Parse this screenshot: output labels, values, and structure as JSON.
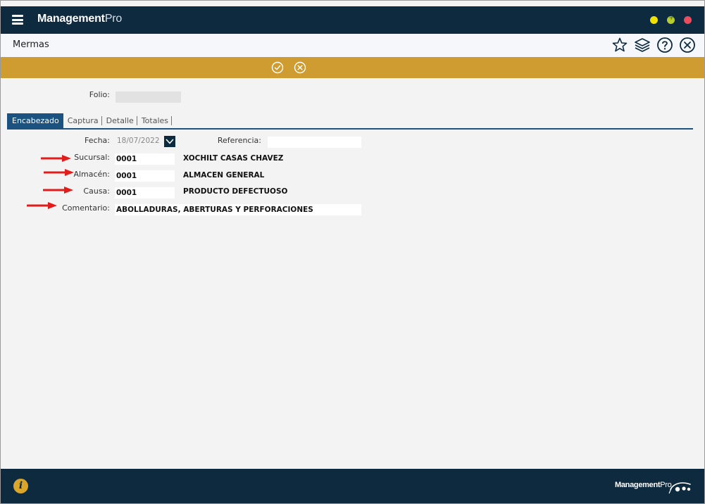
{
  "app": {
    "name_bold": "Management",
    "name_light": "Pro"
  },
  "page": {
    "title": "Mermas"
  },
  "title_icons": [
    "star-icon",
    "layers-icon",
    "help-icon",
    "close-icon"
  ],
  "action_bar": {
    "accept_icon": "check-circle-icon",
    "cancel_icon": "x-circle-icon"
  },
  "form": {
    "folio": {
      "label": "Folio:",
      "value": ""
    },
    "tabs": [
      "Encabezado",
      "Captura",
      "Detalle",
      "Totales"
    ],
    "active_tab": "Encabezado",
    "fecha": {
      "label": "Fecha:",
      "value": "18/07/2022"
    },
    "referencia": {
      "label": "Referencia:",
      "value": ""
    },
    "sucursal": {
      "label": "Sucursal:",
      "code": "0001",
      "description": "XOCHILT CASAS CHAVEZ"
    },
    "almacen": {
      "label": "Almacén:",
      "code": "0001",
      "description": "ALMACEN GENERAL"
    },
    "causa": {
      "label": "Causa:",
      "code": "0001",
      "description": "PRODUCTO DEFECTUOSO"
    },
    "comentario": {
      "label": "Comentario:",
      "value": "ABOLLADURAS, ABERTURAS Y PERFORACIONES"
    }
  },
  "footer": {
    "brand_bold": "Management",
    "brand_light": "Pro"
  },
  "colors": {
    "navy": "#0e2a3f",
    "gold": "#cf9c31",
    "tab_blue": "#1b527f",
    "arrow_red": "#e21b1b"
  }
}
